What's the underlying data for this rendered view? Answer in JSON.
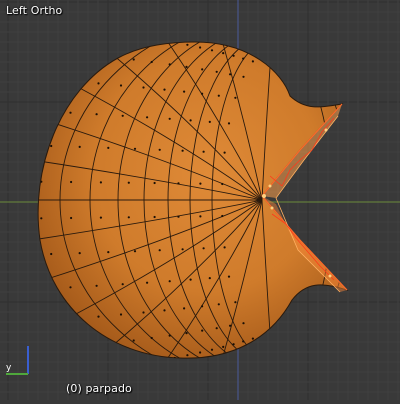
{
  "viewport": {
    "view_name": "Left Ortho",
    "object_info": "(0) parpado",
    "colors": {
      "background": "#393939",
      "grid_minor": "#404040",
      "grid_major": "#2f2f2f",
      "axis_horizontal": "#6b8a3c",
      "axis_vertical": "#4a5a9a",
      "mesh_fill": "#d6802f",
      "mesh_edge": "#2a1a0d",
      "selection": "#ffa04a",
      "selection_edge": "#ff6a2a"
    }
  },
  "gizmo": {
    "y_label": "y",
    "axis_y_color": "#4fa83c",
    "axis_z_color": "#3a5fd0"
  }
}
